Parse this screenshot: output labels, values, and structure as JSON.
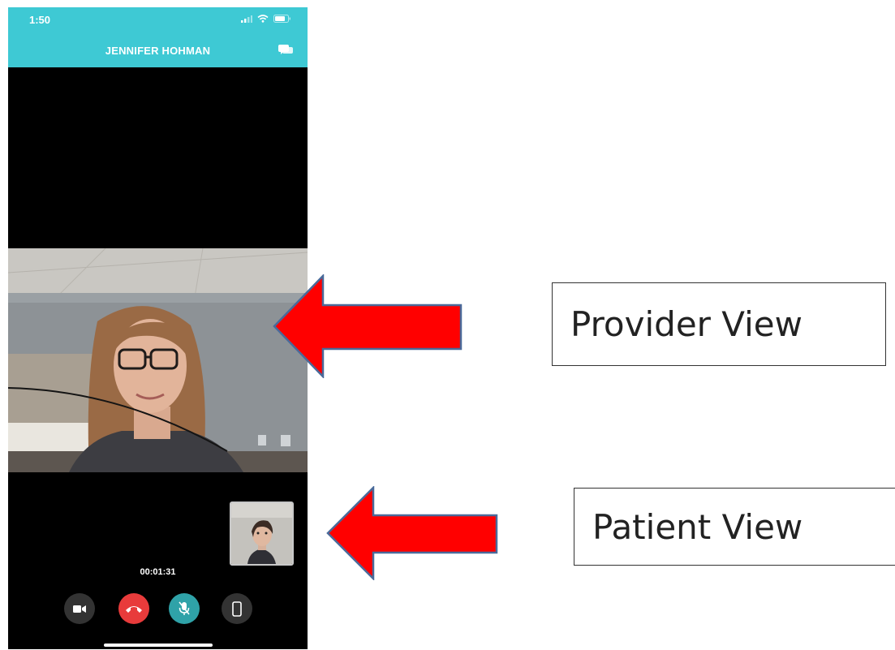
{
  "status_bar": {
    "time": "1:50",
    "icons": [
      "signal-icon",
      "wifi-icon",
      "battery-icon"
    ]
  },
  "header": {
    "title": "JENNIFER HOHMAN",
    "action_icon": "chat-icon"
  },
  "call": {
    "timer": "00:01:31",
    "controls": [
      {
        "name": "video-camera-icon",
        "state": "on"
      },
      {
        "name": "end-call-icon",
        "state": "active"
      },
      {
        "name": "microphone-muted-icon",
        "state": "muted"
      },
      {
        "name": "phone-device-icon",
        "state": "on"
      }
    ]
  },
  "annotations": {
    "provider_label": "Provider View",
    "patient_label": "Patient View"
  },
  "colors": {
    "header": "#3ec9d4",
    "end_call": "#e83b3b",
    "mute": "#2fa2a8",
    "arrow_fill": "#ff0000",
    "arrow_stroke": "#4a6a9a"
  }
}
